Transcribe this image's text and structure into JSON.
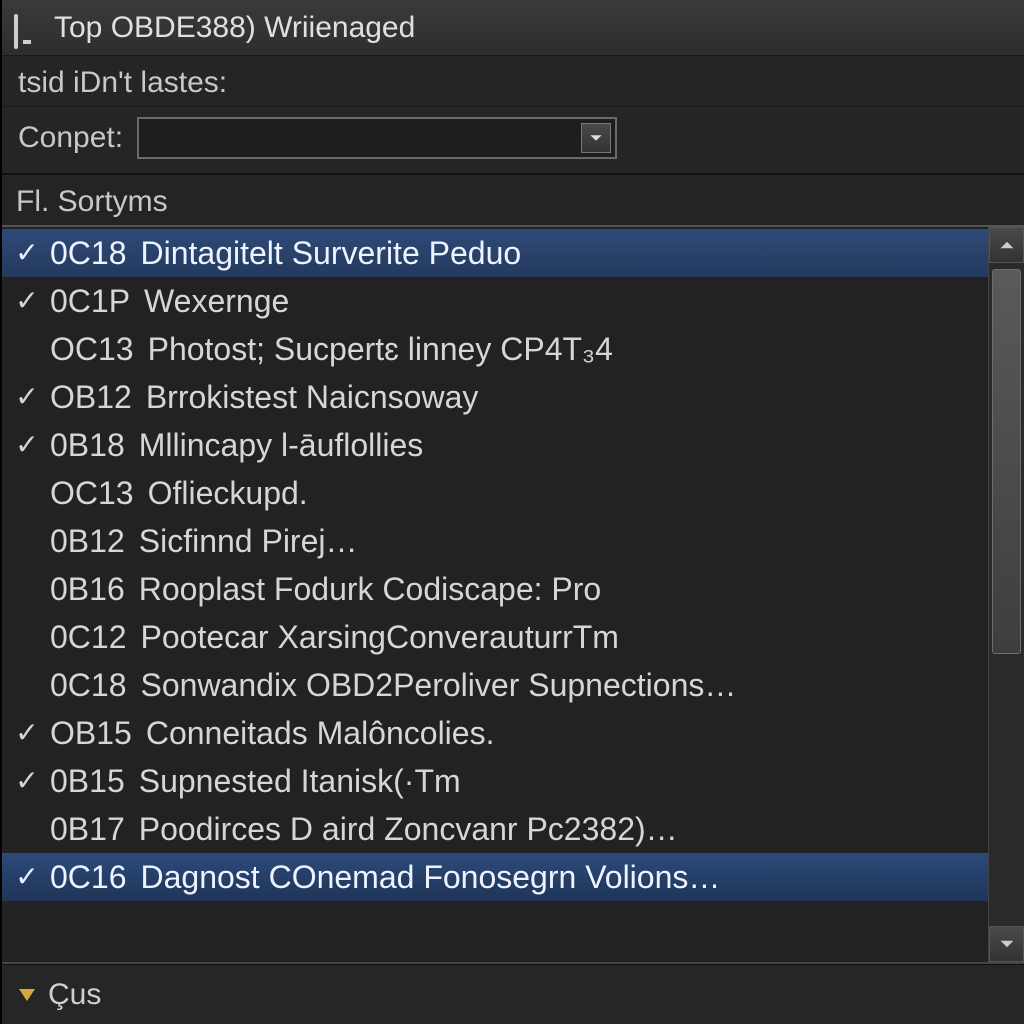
{
  "titlebar": {
    "title": "Top OBDE388) Wriienaged"
  },
  "subheader": {
    "label": "tsid iDn't lastes:"
  },
  "field": {
    "label": "Conpet:",
    "value": ""
  },
  "section_label": "Fl. Sortyms",
  "footer": {
    "label": "Çus"
  },
  "list": {
    "items": [
      {
        "checked": true,
        "code": "0C18",
        "text": "Dintagitelt Surverite Peduo",
        "selected": "top"
      },
      {
        "checked": true,
        "code": "0C1P",
        "text": "Wexernge",
        "selected": ""
      },
      {
        "checked": false,
        "code": "OC13",
        "text": "Photost; Sucpertɛ linney CP4T₃4",
        "selected": ""
      },
      {
        "checked": true,
        "code": "OB12",
        "text": "Brrokistest Naicnsoway",
        "selected": ""
      },
      {
        "checked": true,
        "code": "0B18",
        "text": "Mllincapy l-āuflollies",
        "selected": ""
      },
      {
        "checked": false,
        "code": "OC13",
        "text": "Oflieckupd.",
        "selected": ""
      },
      {
        "checked": false,
        "code": "0B12",
        "text": "Sicfinnd Pirej…",
        "selected": ""
      },
      {
        "checked": false,
        "code": "0B16",
        "text": "Rooplast Fodurk Codiscape: Pro",
        "selected": ""
      },
      {
        "checked": false,
        "code": "0C12",
        "text": "Pootecar XarsingConverauturrTm",
        "selected": ""
      },
      {
        "checked": false,
        "code": "0C18",
        "text": "Sonwandix OBD2Peroliver Supnections…",
        "selected": ""
      },
      {
        "checked": true,
        "code": "OB15",
        "text": "Conneitads Malôncolies.",
        "selected": ""
      },
      {
        "checked": true,
        "code": "0B15",
        "text": "Supnested Itanisk(·Tm",
        "selected": ""
      },
      {
        "checked": false,
        "code": "0B17",
        "text": "Poodirces D aird Zoncvanr Pc2382)…",
        "selected": ""
      },
      {
        "checked": true,
        "code": "0C16",
        "text": "Dagnost COnemad Fonosegrn Volions…",
        "selected": "bot"
      }
    ]
  }
}
